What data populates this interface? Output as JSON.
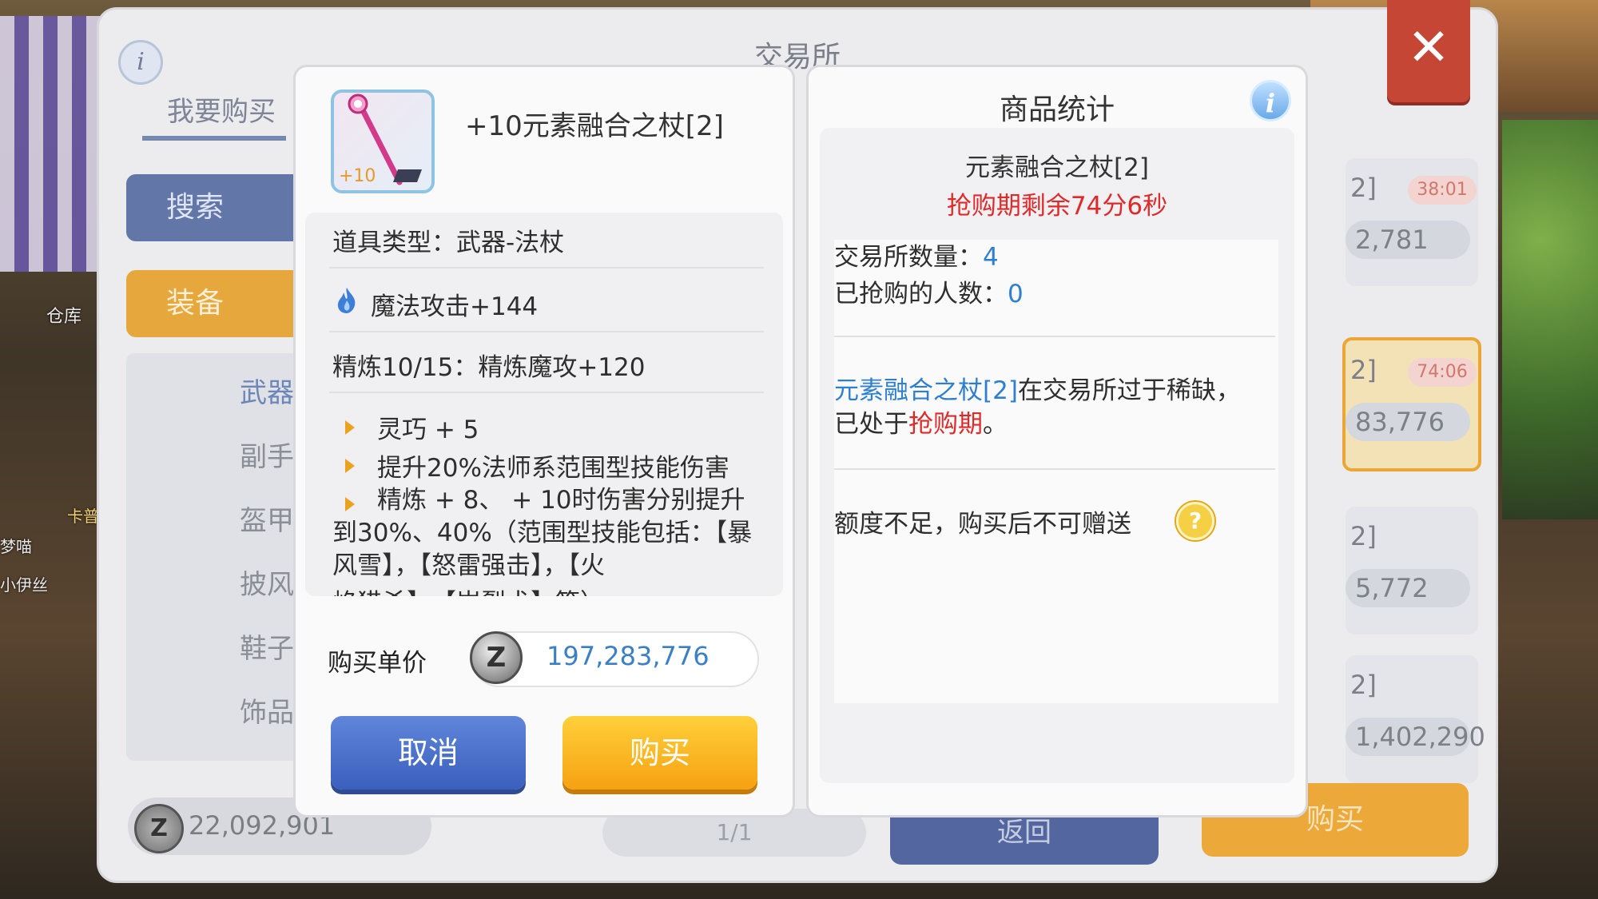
{
  "background": {
    "side_labels": [
      "仓库",
      "卡普",
      "梦喵",
      "小伊丝"
    ]
  },
  "exchange": {
    "title": "交易所",
    "tab_buy": "我要购买",
    "btn_search": "搜索",
    "btn_equipment": "装备",
    "categories": [
      "武器",
      "副手",
      "盔甲",
      "披风",
      "鞋子",
      "饰品"
    ],
    "coins": "22,092,901",
    "page": "1/1",
    "btn_return": "返回",
    "btn_buy": "购买",
    "cards": [
      {
        "title": "2]",
        "timer": "38:01",
        "price": "2,781"
      },
      {
        "title": "2]",
        "timer": "74:06",
        "price": "83,776"
      },
      {
        "title": "2]",
        "timer": "",
        "price": "5,772"
      },
      {
        "title": "2]",
        "timer": "",
        "price": "1,402,290"
      }
    ]
  },
  "item_detail": {
    "refine_badge": "+10",
    "name": "+10元素融合之杖[2]",
    "type": "道具类型：武器-法杖",
    "magic_attack": "魔法攻击+144",
    "refine": "精炼10/15：精炼魔攻+120",
    "effects": [
      "灵巧 + 5",
      "提升20%法师系范围型技能伤害",
      "精炼 + 8、 + 10时伤害分别提升到30%、40%（范围型技能包括：【暴风雪】，【怒雷强击】，【火",
      "焰猎杀】，【岩裂术】等）"
    ],
    "price_label": "购买单价",
    "price_value": "197,283,776",
    "btn_cancel": "取消",
    "btn_buy": "购买"
  },
  "stats": {
    "title": "商品统计",
    "item_name": "元素融合之杖[2]",
    "timer": "抢购期剩余74分6秒",
    "exchange_qty_label": "交易所数量：",
    "exchange_qty_value": "4",
    "buyers_label": "已抢购的人数：",
    "buyers_value": "0",
    "scarcity_item": "元素融合之杖[2]",
    "scarcity_text1": "在交易所过于稀缺，",
    "scarcity_text2": "已处于",
    "scarcity_highlight": "抢购期",
    "scarcity_text3": "。",
    "quota_note": "额度不足，购买后不可赠送"
  },
  "colors": {
    "accent_blue": "#3b7fc4",
    "alert_red": "#e02a2a",
    "buy_orange": "#f6a112",
    "cancel_blue": "#3a5fbd"
  },
  "icons": [
    "info-icon",
    "close-icon",
    "flame-icon",
    "zeny-coin-icon",
    "help-icon",
    "bullet-arrow-icon"
  ]
}
